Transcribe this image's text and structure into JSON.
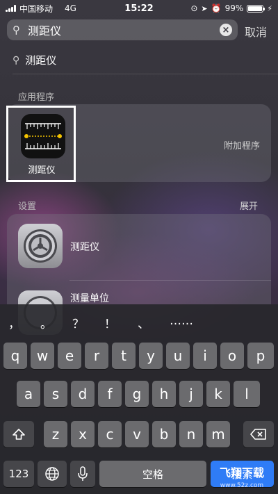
{
  "status": {
    "carrier": "中国移动",
    "network": "4G",
    "time": "15:22",
    "battery": "99%",
    "battery_level": 0.99
  },
  "search": {
    "query": "测距仪",
    "cancel_label": "取消"
  },
  "suggestion": {
    "label": "测距仪"
  },
  "sections": {
    "apps_title": "应用程序",
    "settings_title": "设置",
    "expand_label": "展开"
  },
  "app_result": {
    "name": "测距仪",
    "addon_label": "附加程序"
  },
  "settings_results": [
    {
      "label": "测距仪"
    },
    {
      "label": "测量单位"
    }
  ],
  "keyboard": {
    "punctuation": [
      "，",
      "。",
      "？",
      "！",
      "、",
      "……"
    ],
    "row1": [
      "q",
      "w",
      "e",
      "r",
      "t",
      "y",
      "u",
      "i",
      "o",
      "p"
    ],
    "row2": [
      "a",
      "s",
      "d",
      "f",
      "g",
      "h",
      "j",
      "k",
      "l"
    ],
    "row3": [
      "z",
      "x",
      "c",
      "v",
      "b",
      "n",
      "m"
    ],
    "numbers_label": "123",
    "space_label": "空格",
    "go_label": "搜索"
  },
  "watermark": {
    "title": "飞翔下载",
    "url": "www.52z.com"
  },
  "colors": {
    "accent": "#2f7cf6",
    "ruler_dot": "#f5c400"
  }
}
